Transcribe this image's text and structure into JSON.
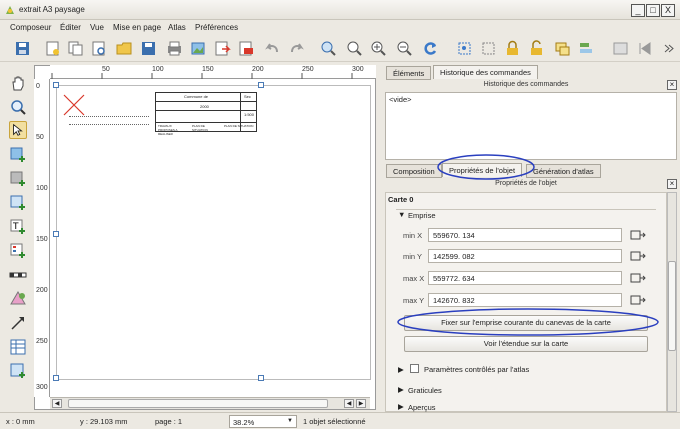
{
  "window": {
    "title": "extrait A3 paysage",
    "min": "_",
    "max": "□",
    "close": "X"
  },
  "menu": [
    "Composeur",
    "Éditer",
    "Vue",
    "Mise en page",
    "Atlas",
    "Préférences"
  ],
  "ruler": {
    "h": [
      "50",
      "100",
      "150",
      "200",
      "250",
      "300"
    ],
    "v": [
      "0",
      "50",
      "100",
      "150",
      "200",
      "250",
      "300"
    ]
  },
  "page_title_block": {
    "commune_label": "Commune de",
    "sec_label": "Sec",
    "scale": "1:500",
    "year": "2000",
    "cols": [
      "TRAVAUX PROPOSES A REALISER",
      "PLAN DE SITUATION",
      "PLAN DE SITUATION"
    ]
  },
  "right_panel": {
    "top_tabs": [
      "Éléments",
      "Historique des commandes"
    ],
    "history_header": "Historique des commandes",
    "history_item": "<vide>",
    "mid_tabs": [
      "Composition",
      "Propriétés de l'objet",
      "Génération d'atlas"
    ],
    "props_header": "Propriétés de l'objet",
    "item_title": "Carte 0",
    "extent_section": "Emprise",
    "fields": [
      {
        "label": "min X",
        "value": "559670. 134"
      },
      {
        "label": "min Y",
        "value": "142599. 082"
      },
      {
        "label": "max X",
        "value": "559772. 634"
      },
      {
        "label": "max Y",
        "value": "142670. 832"
      }
    ],
    "btn_set_extent": "Fixer sur l'emprise courante du canevas de la carte",
    "btn_view_extent": "Voir l'étendue sur la carte",
    "atlas_checkbox": "Paramètres contrôlés par l'atlas",
    "graticules": "Graticules",
    "apercus": "Aperçus"
  },
  "status": {
    "x": "x : 0 mm",
    "y": "y : 29.103 mm",
    "page": "page : 1",
    "zoom": "38.2%",
    "selection": "1 objet sélectionné"
  },
  "colors": {
    "highlight": "#2a3fbf",
    "accent_icon": "#3a79c9",
    "red_mark": "#d9382b"
  }
}
